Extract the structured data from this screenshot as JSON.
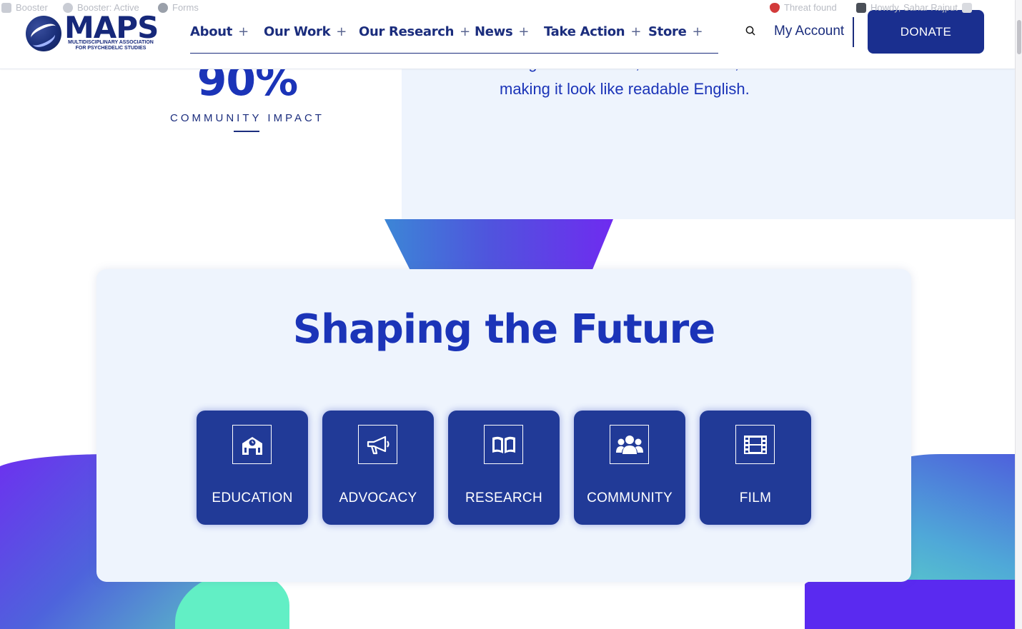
{
  "admin_bar": {
    "items": [
      "Booster",
      "Booster: Active",
      "Forms"
    ],
    "threat": "Threat found",
    "howdy": "Howdy, Sahar Rajput"
  },
  "header": {
    "logo": {
      "word": "MAPS",
      "subtitle": "MULTIDISCIPLINARY ASSOCIATION FOR PSYCHEDELIC STUDIES"
    },
    "nav": [
      {
        "label": "About",
        "expand": "+"
      },
      {
        "label": "Our Work",
        "expand": "+"
      },
      {
        "label": "Our Research",
        "expand": "+"
      },
      {
        "label": "News",
        "expand": "+"
      },
      {
        "label": "Take Action",
        "expand": "+"
      },
      {
        "label": "Store",
        "expand": "+"
      }
    ],
    "search_icon": "search-icon",
    "account_label": "My Account",
    "donate_label": "DONATE"
  },
  "stat": {
    "value": "90%",
    "label": "COMMUNITY IMPACT"
  },
  "panel": {
    "cut_text": "using 'Content here, content here',",
    "text": "making it look like readable English."
  },
  "section": {
    "title": "Shaping the Future",
    "tiles": [
      {
        "label": "EDUCATION",
        "icon": "school-icon"
      },
      {
        "label": "ADVOCACY",
        "icon": "megaphone-icon"
      },
      {
        "label": "RESEARCH",
        "icon": "book-icon"
      },
      {
        "label": "COMMUNITY",
        "icon": "users-icon"
      },
      {
        "label": "FILM",
        "icon": "film-icon"
      }
    ]
  },
  "colors": {
    "brand_navy": "#1b2d7d",
    "accent_blue": "#1b34b8",
    "tile_bg": "#213a97",
    "panel_bg": "#eef4fd"
  }
}
